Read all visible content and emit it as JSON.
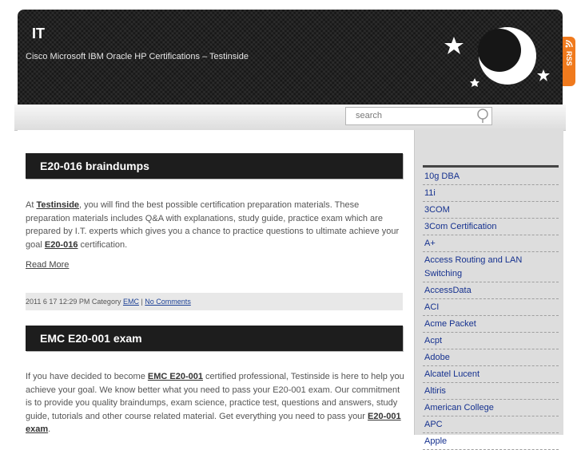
{
  "header": {
    "title": "IT",
    "description": "Cisco Microsoft IBM Oracle HP Certifications – Testinside",
    "rss_label": "RSS"
  },
  "search": {
    "placeholder": "search"
  },
  "icons": {
    "search": "search-icon",
    "rss": "rss-icon",
    "moon": "moon-icon",
    "star": "star-icon"
  },
  "posts": [
    {
      "title": "E20-016 braindumps",
      "body_prefix": "At ",
      "link1": "Testinside",
      "body_mid": ", you will find the best possible certification preparation materials. These preparation materials includes Q&A with explanations, study guide, practice exam which are prepared by I.T. experts which gives you a chance to practice questions to ultimate achieve your goal ",
      "link2": "E20-016",
      "body_suffix": " certification.",
      "read_more": "Read More",
      "meta_date": "2011 6 17 12:29 PM",
      "meta_category_label": "Category ",
      "meta_category": "EMC",
      "meta_sep": " | ",
      "meta_comments": "No Comments"
    },
    {
      "title": "EMC E20-001 exam",
      "body_prefix": "If you have decided to become ",
      "link1": "EMC E20-001",
      "body_mid": " certified professional, Testinside is here to help you achieve your goal. We know better what you need to pass your E20-001 exam. Our commitment is to provide you quality braindumps, exam science, practice test, questions and answers, study guide, tutorials and other course related material. Get everything you need to pass your ",
      "link2": "E20-001 exam",
      "body_suffix": "."
    }
  ],
  "sidebar": {
    "categories": [
      "10g DBA",
      "11i",
      "3COM",
      "3Com Certification",
      "A+",
      "Access Routing and LAN Switching",
      "AccessData",
      "ACI",
      "Acme Packet",
      "Acpt",
      "Adobe",
      "Alcatel Lucent",
      "Altiris",
      "American College",
      "APC",
      "Apple"
    ]
  },
  "colors": {
    "header_bg": "#161616",
    "rss_orange": "#f07a1d",
    "link_blue": "#15318f",
    "title_bar": "#1d1d1d"
  }
}
